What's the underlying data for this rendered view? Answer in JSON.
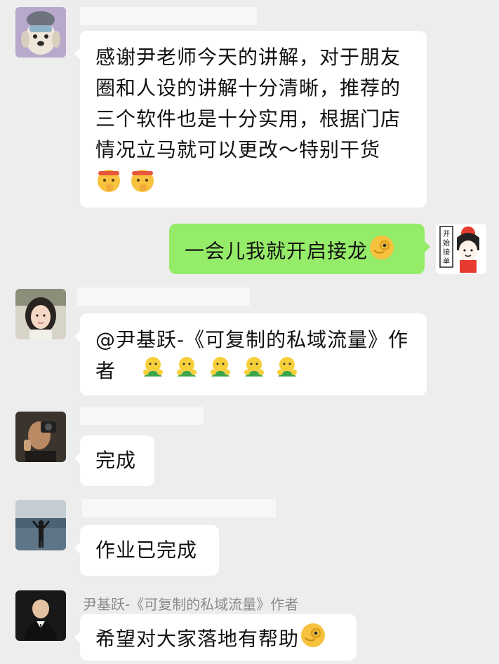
{
  "messages": [
    {
      "id": "m1",
      "side": "left",
      "text": "感谢尹老师今天的讲解，对于朋友圈和人设的讲解十分清晰，推荐的三个软件也是十分实用，根据门店情况立马就可以更改～特别干货",
      "lines": [
        "感谢尹老师今天的讲解，对于朋友",
        "圈和人设的讲解十分清晰，推荐的",
        "三个软件也是十分实用，根据门店",
        "情况立马就可以更改～特别干货"
      ],
      "trailing_emoji": [
        "shush-emoji",
        "shush-emoji"
      ]
    },
    {
      "id": "m2",
      "side": "right",
      "text": "一会儿我就开启接龙",
      "trailing_emoji": [
        "okay-hand-emoji"
      ],
      "sticker_text": "开始接单"
    },
    {
      "id": "m3",
      "side": "left",
      "lines": [
        "@尹基跃-《可复制的私域流量》作",
        "者"
      ],
      "trailing_emoji": [
        "wechat-applause-emoji",
        "wechat-applause-emoji",
        "wechat-applause-emoji",
        "wechat-applause-emoji",
        "wechat-applause-emoji"
      ]
    },
    {
      "id": "m4",
      "side": "left",
      "text": "完成"
    },
    {
      "id": "m5",
      "side": "left",
      "text": "作业已完成"
    },
    {
      "id": "m6",
      "side": "left",
      "sender": "尹基跃-《可复制的私域流量》作者",
      "text": "希望对大家落地有帮助",
      "trailing_emoji": [
        "okay-hand-emoji"
      ]
    }
  ],
  "colors": {
    "background": "#ededed",
    "bubble_left": "#ffffff",
    "bubble_mine": "#95ec69",
    "sender_name": "#8a8a8a"
  }
}
